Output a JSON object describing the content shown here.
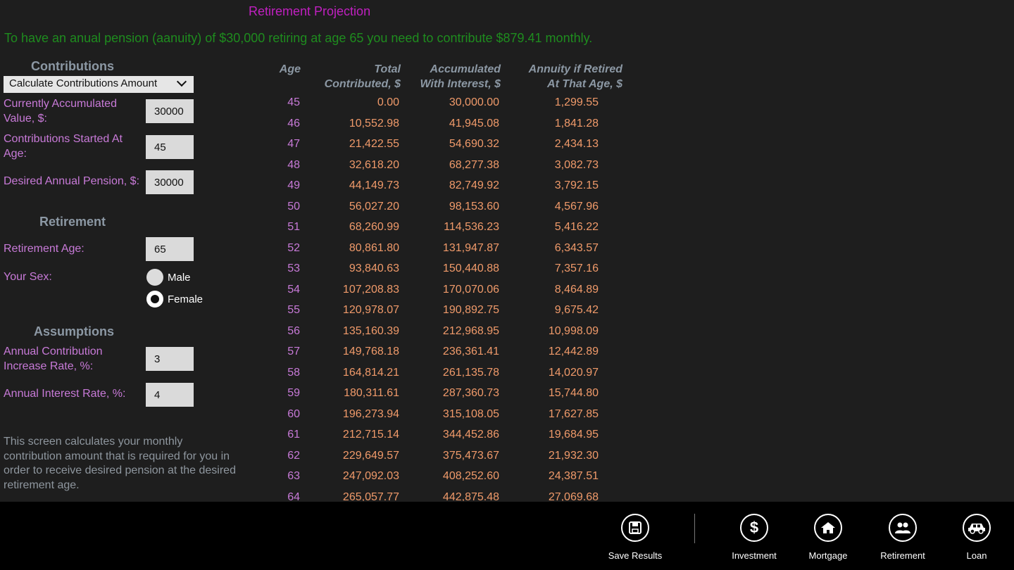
{
  "page": {
    "title": "Retirement Projection",
    "summary": "To have an anual pension (aanuity) of $30,000 retiring at age 65 you need to contribute $879.41 monthly."
  },
  "contributions": {
    "heading": "Contributions",
    "mode_select": "Calculate Contributions Amount",
    "current_value_label": "Currently Accumulated Value, $:",
    "current_value": "30000",
    "start_age_label": "Contributions Started At Age:",
    "start_age": "45",
    "pension_label": "Desired Annual Pension, $:",
    "pension": "30000"
  },
  "retirement": {
    "heading": "Retirement",
    "age_label": "Retirement Age:",
    "age": "65",
    "sex_label": "Your Sex:",
    "sex_options": [
      "Male",
      "Female"
    ],
    "sex_selected": "Female"
  },
  "assumptions": {
    "heading": "Assumptions",
    "contrib_rate_label": "Annual Contribution Increase Rate, %:",
    "contrib_rate": "3",
    "interest_label": "Annual Interest Rate, %:",
    "interest": "4"
  },
  "description": "This screen calculates your monthly contribution amount that is required for you in order to receive desired pension at the desired retirement age.",
  "table": {
    "headers": {
      "age": "Age",
      "total_1": "Total",
      "total_2": "Contributed, $",
      "accum_1": "Accumulated",
      "accum_2": "With Interest, $",
      "annuity_1": "Annuity if Retired",
      "annuity_2": "At That Age, $"
    },
    "rows": [
      [
        "45",
        "0.00",
        "30,000.00",
        "1,299.55"
      ],
      [
        "46",
        "10,552.98",
        "41,945.08",
        "1,841.28"
      ],
      [
        "47",
        "21,422.55",
        "54,690.32",
        "2,434.13"
      ],
      [
        "48",
        "32,618.20",
        "68,277.38",
        "3,082.73"
      ],
      [
        "49",
        "44,149.73",
        "82,749.92",
        "3,792.15"
      ],
      [
        "50",
        "56,027.20",
        "98,153.60",
        "4,567.96"
      ],
      [
        "51",
        "68,260.99",
        "114,536.23",
        "5,416.22"
      ],
      [
        "52",
        "80,861.80",
        "131,947.87",
        "6,343.57"
      ],
      [
        "53",
        "93,840.63",
        "150,440.88",
        "7,357.16"
      ],
      [
        "54",
        "107,208.83",
        "170,070.06",
        "8,464.89"
      ],
      [
        "55",
        "120,978.07",
        "190,892.75",
        "9,675.42"
      ],
      [
        "56",
        "135,160.39",
        "212,968.95",
        "10,998.09"
      ],
      [
        "57",
        "149,768.18",
        "236,361.41",
        "12,442.89"
      ],
      [
        "58",
        "164,814.21",
        "261,135.78",
        "14,020.97"
      ],
      [
        "59",
        "180,311.61",
        "287,360.73",
        "15,744.80"
      ],
      [
        "60",
        "196,273.94",
        "315,108.05",
        "17,627.85"
      ],
      [
        "61",
        "212,715.14",
        "344,452.86",
        "19,684.95"
      ],
      [
        "62",
        "229,649.57",
        "375,473.67",
        "21,932.30"
      ],
      [
        "63",
        "247,092.03",
        "408,252.60",
        "24,387.51"
      ],
      [
        "64",
        "265,057.77",
        "442,875.48",
        "27,069.68"
      ]
    ]
  },
  "appbar": {
    "save": "Save Results",
    "investment": "Investment",
    "mortgage": "Mortgage",
    "retirement": "Retirement",
    "loan": "Loan"
  }
}
